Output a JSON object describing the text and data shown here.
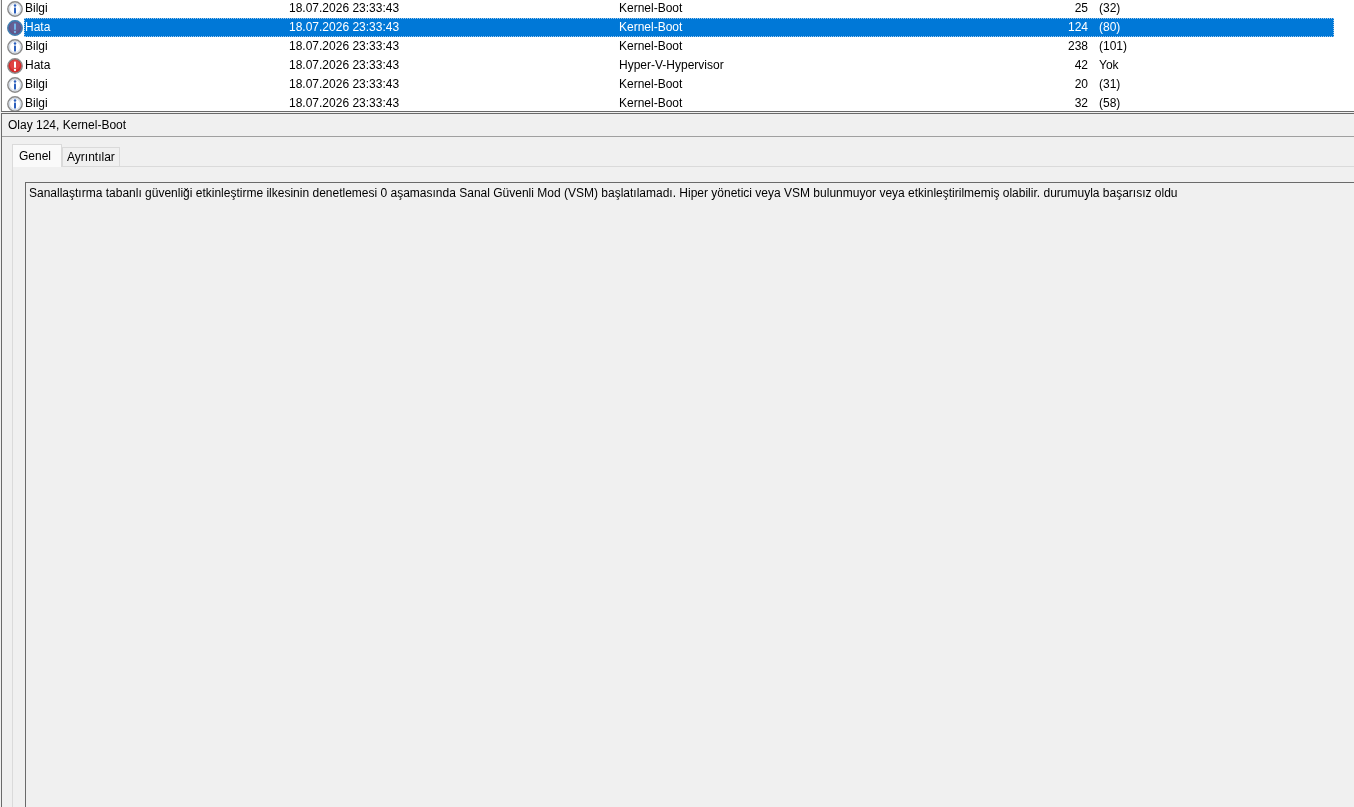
{
  "event_list": {
    "rows": [
      {
        "kind": "info",
        "level": "Bilgi",
        "date_time": "18.07.2026 23:33:43",
        "source": "Kernel-Boot",
        "event_id": "25",
        "task_category": "(32)",
        "selected": false
      },
      {
        "kind": "error",
        "level": "Hata",
        "date_time": "18.07.2026 23:33:43",
        "source": "Kernel-Boot",
        "event_id": "124",
        "task_category": "(80)",
        "selected": true
      },
      {
        "kind": "info",
        "level": "Bilgi",
        "date_time": "18.07.2026 23:33:43",
        "source": "Kernel-Boot",
        "event_id": "238",
        "task_category": "(101)",
        "selected": false
      },
      {
        "kind": "error",
        "level": "Hata",
        "date_time": "18.07.2026 23:33:43",
        "source": "Hyper-V-Hypervisor",
        "event_id": "42",
        "task_category": "Yok",
        "selected": false
      },
      {
        "kind": "info",
        "level": "Bilgi",
        "date_time": "18.07.2026 23:33:43",
        "source": "Kernel-Boot",
        "event_id": "20",
        "task_category": "(31)",
        "selected": false
      },
      {
        "kind": "info",
        "level": "Bilgi",
        "date_time": "18.07.2026 23:33:43",
        "source": "Kernel-Boot",
        "event_id": "32",
        "task_category": "(58)",
        "selected": false
      }
    ]
  },
  "detail": {
    "title": "Olay 124, Kernel-Boot",
    "tabs": [
      {
        "label": "Genel",
        "selected": true
      },
      {
        "label": "Ayrıntılar",
        "selected": false
      }
    ],
    "description": "Sanallaştırma tabanlı güvenliği etkinleştirme ilkesinin denetlemesi 0 aşamasında Sanal Güvenli Mod (VSM) başlatılamadı. Hiper yönetici veya VSM bulunmuyor veya etkinleştirilmemiş olabilir. durumuyla başarısız oldu"
  }
}
